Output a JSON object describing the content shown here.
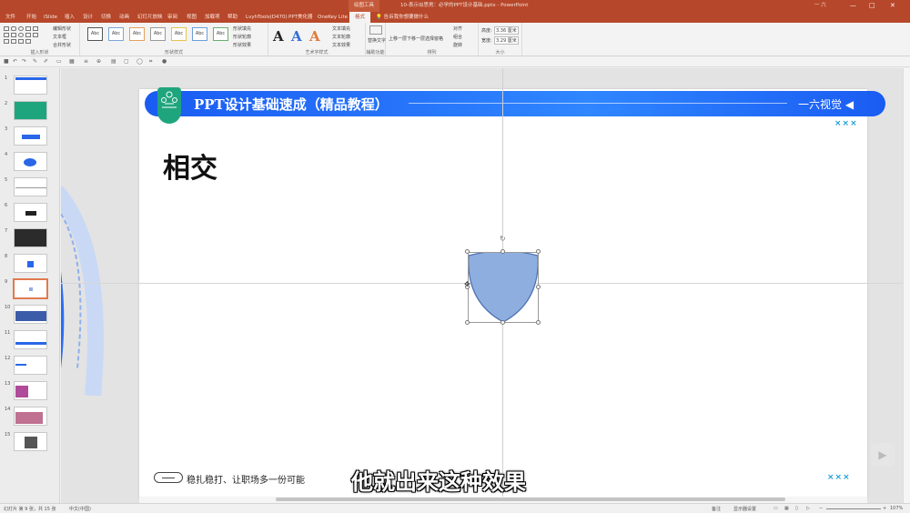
{
  "titlebar": {
    "context_tool": "绘图工具",
    "document": "10-表示似思男：必学的PPT设计基础.pptx  -  PowerPoint",
    "user": "一 六",
    "minimize": "—",
    "maximize": "□",
    "close": "✕"
  },
  "tabs": [
    "文件",
    "开始",
    "iSlide",
    "插入",
    "设计",
    "切换",
    "动画",
    "幻灯片放映",
    "审阅",
    "视图",
    "加载项",
    "帮助",
    "LvyhTools(D470)",
    "PPT美化器",
    "OneKey Lite",
    "格式"
  ],
  "tell_me": "告诉我你想要做什么",
  "ribbon": {
    "insert_shapes": {
      "edit_shape": "编辑形状",
      "text_box": "文本框",
      "merge": "合并形状",
      "label": "插入形状"
    },
    "shape_styles": {
      "sample": "Abc",
      "fill": "形状填充",
      "outline": "形状轮廓",
      "effects": "形状效果",
      "label": "形状样式"
    },
    "wordart": {
      "sample": "A",
      "text_fill": "文本填充",
      "text_outline": "文本轮廓",
      "text_effects": "文本效果",
      "label": "艺术字样式"
    },
    "accessibility": {
      "alt_text": "替换文字",
      "label": "辅助功能"
    },
    "arrange": {
      "bring_forward": "上移一层",
      "send_backward": "下移一层",
      "selection_pane": "选择窗格",
      "align": "对齐",
      "group": "组合",
      "rotate": "旋转",
      "label": "排列"
    },
    "size": {
      "height_label": "高度:",
      "height": "3.36 厘米",
      "width_label": "宽度:",
      "width": "3.29 厘米",
      "label": "大小"
    }
  },
  "thumbnails": {
    "numbers": [
      "1",
      "2",
      "3",
      "4",
      "5",
      "6",
      "7",
      "8",
      "9",
      "10",
      "11",
      "12",
      "13",
      "14",
      "15"
    ],
    "selected": "9"
  },
  "slide": {
    "banner_title": "PPT设计基础速成（精品教程）",
    "banner_brand": "一六视觉 ◀",
    "heading": "相交",
    "marks": "×××",
    "footer_text": "稳扎稳打、让职场多一份可能",
    "shape_fill": "#8eaee0",
    "shape_stroke": "#4a6fb0"
  },
  "subtitle": "他就出来这种效果",
  "status": {
    "slide_info": "幻灯片 第 9 张，共 15 张",
    "language": "中文(中国)",
    "notes": "备注",
    "comments": "显示器设置",
    "zoom": "107%"
  },
  "colors": {
    "accent": "#b7472a",
    "banner": "#2a6cf5",
    "badge": "#1fa57d"
  }
}
